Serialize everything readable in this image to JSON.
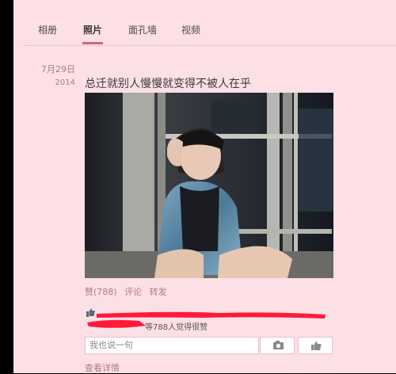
{
  "nav": {
    "tabs": [
      "相册",
      "照片",
      "面孔墙",
      "视频"
    ],
    "active_index": 1
  },
  "post": {
    "date_day": "7月29日",
    "date_year": "2014",
    "title": "总迁就别人慢慢就变得不被人在乎",
    "photo_icon": "photo-image",
    "actions": {
      "like": "赞(788)",
      "comment": "评论",
      "share": "转发"
    },
    "likes_summary": "等788人觉得很赞",
    "comment_placeholder": "我也说一句",
    "more_link": "查看详情"
  },
  "colors": {
    "page_bg": "#fde0e6",
    "accent": "#c96a7a",
    "redaction": "#ff1a3a"
  }
}
